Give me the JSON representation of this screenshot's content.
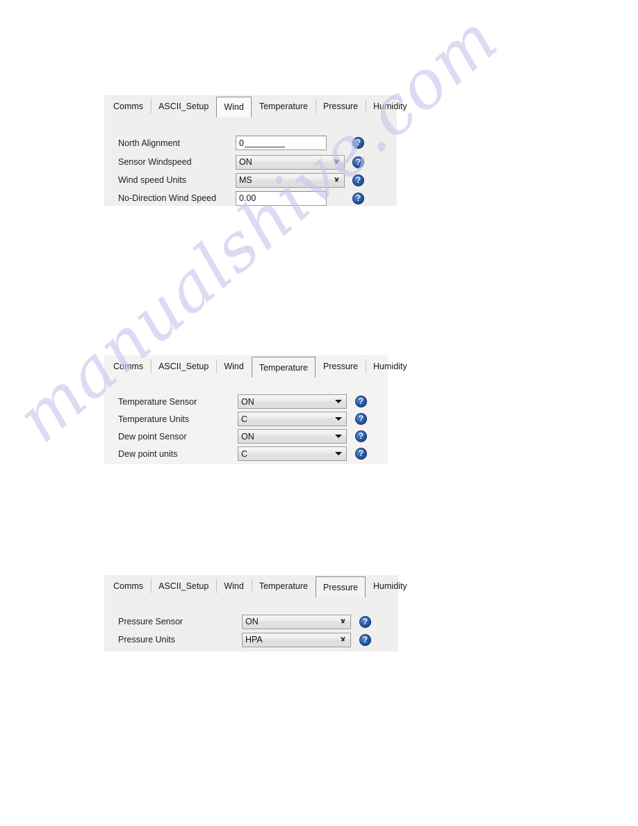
{
  "watermark": {
    "text": "manualshive.com"
  },
  "tabs": [
    "Comms",
    "ASCII_Setup",
    "Wind",
    "Temperature",
    "Pressure",
    "Humidity"
  ],
  "panels": [
    {
      "id": "wind-panel",
      "selected_tab": "Wind",
      "tabs": [
        "Comms",
        "ASCII_Setup",
        "Wind",
        "Temperature",
        "Pressure",
        "Humidity"
      ],
      "rows": [
        {
          "label": "North Alignment",
          "control": "text",
          "value": "0",
          "help": "?"
        },
        {
          "label": "Sensor Windspeed",
          "control": "combo",
          "value": "ON",
          "help": "?"
        },
        {
          "label": "Wind speed Units",
          "control": "combo",
          "value": "MS",
          "help": "?"
        },
        {
          "label": "No-Direction Wind Speed",
          "control": "text",
          "value": "0.00",
          "help": "?"
        }
      ]
    },
    {
      "id": "temperature-panel",
      "selected_tab": "Temperature",
      "tabs": [
        "Comms",
        "ASCII_Setup",
        "Wind",
        "Temperature",
        "Pressure",
        "Humidity"
      ],
      "rows": [
        {
          "label": "Temperature Sensor",
          "control": "combo",
          "value": "ON",
          "help": "?"
        },
        {
          "label": "Temperature Units",
          "control": "combo",
          "value": "C",
          "help": "?"
        },
        {
          "label": "Dew point Sensor",
          "control": "combo",
          "value": "ON",
          "help": "?"
        },
        {
          "label": "Dew point units",
          "control": "combo",
          "value": "C",
          "help": "?"
        }
      ]
    },
    {
      "id": "pressure-panel",
      "selected_tab": "Pressure",
      "tabs": [
        "Comms",
        "ASCII_Setup",
        "Wind",
        "Temperature",
        "Pressure",
        "Humidity"
      ],
      "rows": [
        {
          "label": "Pressure Sensor",
          "control": "combo",
          "value": "ON",
          "help": "?"
        },
        {
          "label": "Pressure Units",
          "control": "combo",
          "value": "HPA",
          "help": "?"
        }
      ]
    }
  ],
  "colors": {
    "panel_bg": "#f0efed",
    "input_bg": "#ffffff",
    "combo_bg": "#e6e6e4",
    "border": "#9b9b99",
    "text": "#15171a",
    "help_blue": "#2f63b5",
    "watermark": "#c9c6ec"
  }
}
